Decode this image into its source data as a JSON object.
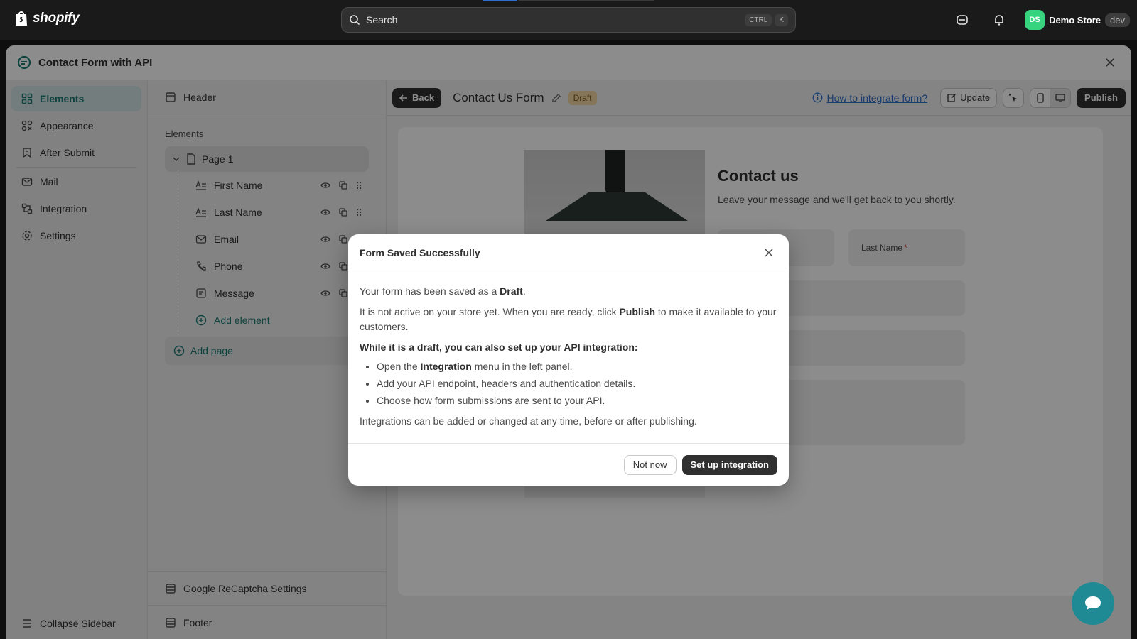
{
  "topbar": {
    "brand": "shopify",
    "search_placeholder": "Search",
    "shortcut_keys": [
      "CTRL",
      "K"
    ],
    "store_initials": "DS",
    "store_name": "Demo Store",
    "store_badge": "dev",
    "avatar_color": "#36d47e"
  },
  "app": {
    "title": "Contact Form with API",
    "accent_color": "#1b7a74"
  },
  "sidebar": {
    "items": [
      {
        "label": "Elements",
        "icon": "grid-icon",
        "active": true
      },
      {
        "label": "Appearance",
        "icon": "appearance-icon"
      },
      {
        "label": "After Submit",
        "icon": "after-submit-icon"
      },
      {
        "label": "Mail",
        "icon": "mail-icon"
      },
      {
        "label": "Integration",
        "icon": "integration-icon"
      },
      {
        "label": "Settings",
        "icon": "gear-icon"
      }
    ],
    "collapse_label": "Collapse Sidebar"
  },
  "panel": {
    "header_label": "Header",
    "section_label": "Elements",
    "page_label": "Page 1",
    "elements": [
      {
        "label": "First Name",
        "icon": "text-field-icon"
      },
      {
        "label": "Last Name",
        "icon": "text-field-icon"
      },
      {
        "label": "Email",
        "icon": "mail-icon"
      },
      {
        "label": "Phone",
        "icon": "phone-icon"
      },
      {
        "label": "Message",
        "icon": "message-icon"
      }
    ],
    "add_element_label": "Add element",
    "add_page_label": "Add page",
    "recaptcha_label": "Google ReCaptcha Settings",
    "footer_label": "Footer"
  },
  "toolbar": {
    "back_label": "Back",
    "form_title": "Contact Us Form",
    "status_badge": "Draft",
    "help_link": "How to integrate form?",
    "update_label": "Update",
    "publish_label": "Publish"
  },
  "preview": {
    "title": "Contact us",
    "subtitle": "Leave your message and we'll get back to you shortly.",
    "last_name_label": "Last Name",
    "required_mark": "*"
  },
  "modal": {
    "title": "Form Saved Successfully",
    "line1_prefix": "Your form has been saved as a ",
    "line1_bold": "Draft",
    "line1_suffix": ".",
    "line2_prefix": "It is not active on your store yet. When you are ready, click ",
    "line2_bold": "Publish",
    "line2_suffix": " to make it available to your customers.",
    "draft_heading": "While it is a draft, you can also set up your API integration:",
    "bullet1_prefix": "Open the ",
    "bullet1_bold": "Integration",
    "bullet1_suffix": " menu in the left panel.",
    "bullet2": "Add your API endpoint, headers and authentication details.",
    "bullet3": "Choose how form submissions are sent to your API.",
    "footer_note": "Integrations can be added or changed at any time, before or after publishing.",
    "secondary_button": "Not now",
    "primary_button": "Set up integration"
  }
}
